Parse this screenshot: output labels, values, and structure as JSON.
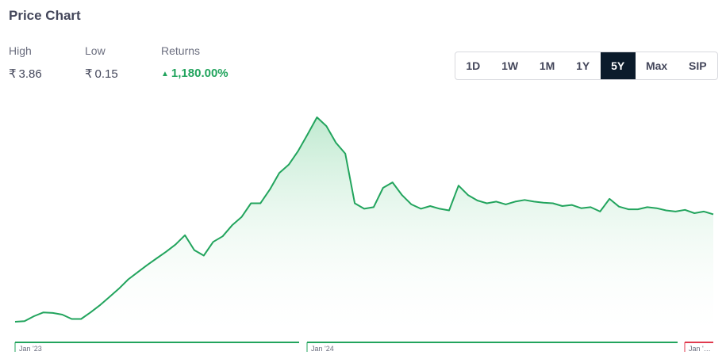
{
  "header": {
    "title": "Price Chart"
  },
  "stats": {
    "high": {
      "label": "High",
      "currency": "₹",
      "value": "3.86"
    },
    "low": {
      "label": "Low",
      "currency": "₹",
      "value": "0.15"
    },
    "returns": {
      "label": "Returns",
      "value": "1,180.00%"
    }
  },
  "range_buttons": [
    {
      "label": "1D",
      "active": false
    },
    {
      "label": "1W",
      "active": false
    },
    {
      "label": "1M",
      "active": false
    },
    {
      "label": "1Y",
      "active": false
    },
    {
      "label": "5Y",
      "active": true
    },
    {
      "label": "Max",
      "active": false
    },
    {
      "label": "SIP",
      "active": false
    }
  ],
  "colors": {
    "line": "#22a45d",
    "area_top": "#b5e6c8",
    "negative": "#e03a4e",
    "active_bg": "#0b1b2b"
  },
  "chart_data": {
    "type": "area",
    "title": "",
    "xlabel": "",
    "ylabel": "",
    "values": [
      0.15,
      0.16,
      0.25,
      0.32,
      0.31,
      0.28,
      0.2,
      0.2,
      0.32,
      0.45,
      0.6,
      0.75,
      0.92,
      1.05,
      1.18,
      1.3,
      1.42,
      1.55,
      1.72,
      1.45,
      1.35,
      1.6,
      1.7,
      1.9,
      2.05,
      2.3,
      2.3,
      2.55,
      2.85,
      3.0,
      3.25,
      3.55,
      3.86,
      3.7,
      3.4,
      3.2,
      2.3,
      2.2,
      2.23,
      2.58,
      2.68,
      2.45,
      2.28,
      2.2,
      2.25,
      2.2,
      2.17,
      2.62,
      2.45,
      2.35,
      2.3,
      2.33,
      2.28,
      2.33,
      2.36,
      2.33,
      2.31,
      2.3,
      2.25,
      2.27,
      2.21,
      2.23,
      2.15,
      2.38,
      2.24,
      2.19,
      2.19,
      2.23,
      2.21,
      2.17,
      2.15,
      2.18,
      2.12,
      2.15,
      2.1
    ],
    "ylim": [
      0.0,
      4.0
    ],
    "periods": [
      {
        "label": "Jan '23",
        "trend": "positive"
      },
      {
        "label": "Jan '24",
        "trend": "positive"
      },
      {
        "label": "Jan '…",
        "trend": "negative"
      }
    ],
    "grid": false,
    "legend": "none"
  }
}
